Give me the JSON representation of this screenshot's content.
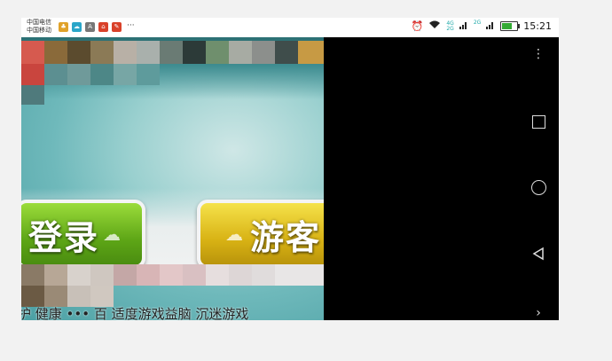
{
  "status_bar": {
    "carrier_1": "中国电信",
    "carrier_2": "中国移动",
    "notification_icons": [
      {
        "icon": "game-app-icon",
        "color": "#e0a22a"
      },
      {
        "icon": "cloud-app-icon",
        "color": "#2aa6c9"
      },
      {
        "icon": "a-app-icon",
        "color": "#777777"
      },
      {
        "icon": "home-app-icon",
        "color": "#d9412a"
      },
      {
        "icon": "tool-app-icon",
        "color": "#d9412a"
      }
    ],
    "more_notifications": "···",
    "network_label_top": "4G",
    "network_label_bottom": "2G",
    "network_label_2": "2G",
    "battery_level": 0.7,
    "time": "15:21"
  },
  "game": {
    "login_label": "登录",
    "guest_label": "游客",
    "footer_text": "护 健康 ••• 百 适度游戏益脑 沉迷游戏"
  },
  "nav_bar": {
    "menu": "⋮",
    "expand": "›"
  },
  "colors": {
    "login_green": "#5da516",
    "guest_yellow": "#d8b214",
    "nav_background": "#000000"
  }
}
